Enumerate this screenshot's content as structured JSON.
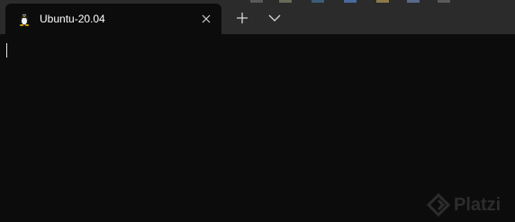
{
  "colors": {
    "titlebar_bg": "#2b2b2b",
    "tab_bg": "#0c0c0c",
    "terminal_bg": "#0c0c0c",
    "text": "#ffffff"
  },
  "top_strip_colors": [
    "#2b2b2b",
    "#5a5a5a",
    "#2b2b2b",
    "#6a6a5a",
    "#2b2b2b",
    "#3b5a7a",
    "#2b2b2b",
    "#4a6a9a",
    "#2b2b2b",
    "#8a7a4a",
    "#2b2b2b",
    "#5a6a8a",
    "#2b2b2b"
  ],
  "tab": {
    "title": "Ubuntu-20.04",
    "icon": "linux-tux-icon",
    "close_icon": "close-icon"
  },
  "toolbar": {
    "new_tab_icon": "plus-icon",
    "dropdown_icon": "chevron-down-icon"
  },
  "watermark": {
    "text": "Platzi",
    "icon": "platzi-logo-icon"
  }
}
